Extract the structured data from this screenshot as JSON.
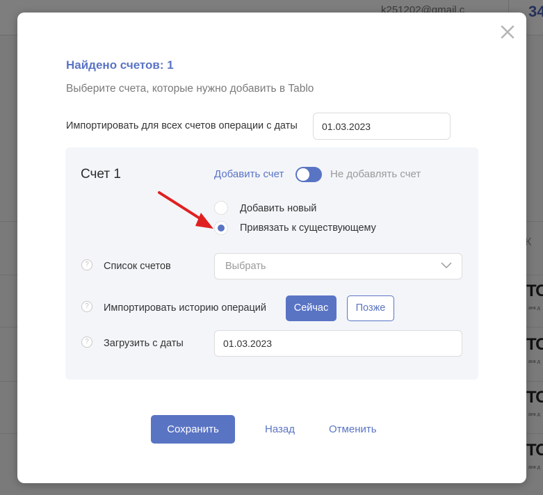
{
  "background": {
    "email": "k251202@gmail.c",
    "number": "34",
    "column_letter": "К",
    "logo_text": "ТО",
    "logo_sub": "анк д"
  },
  "modal": {
    "close_icon": "close-icon",
    "title": "Найдено счетов: 1",
    "subtitle": "Выберите счета, которые нужно добавить в Tablo",
    "import_all_label": "Импортировать для всех счетов операции с даты",
    "import_all_date": "01.03.2023",
    "account": {
      "title": "Счет 1",
      "toggle_on_label": "Добавить счет",
      "toggle_off_label": "Не добавлять счет",
      "toggle_state": true,
      "radio_options": [
        {
          "label": "Добавить новый",
          "selected": false
        },
        {
          "label": "Привязать к существующему",
          "selected": true
        }
      ],
      "accounts_list_label": "Список счетов",
      "accounts_list_placeholder": "Выбрать",
      "import_history_label": "Импортировать историю операций",
      "now_button": "Сейчас",
      "later_button": "Позже",
      "load_from_label": "Загрузить с даты",
      "load_from_date": "01.03.2023",
      "help_icon_glyph": "?"
    },
    "save_button": "Сохранить",
    "back_link": "Назад",
    "cancel_link": "Отменить"
  },
  "colors": {
    "accent": "#5a74c4",
    "annotation_arrow": "#e02020"
  }
}
